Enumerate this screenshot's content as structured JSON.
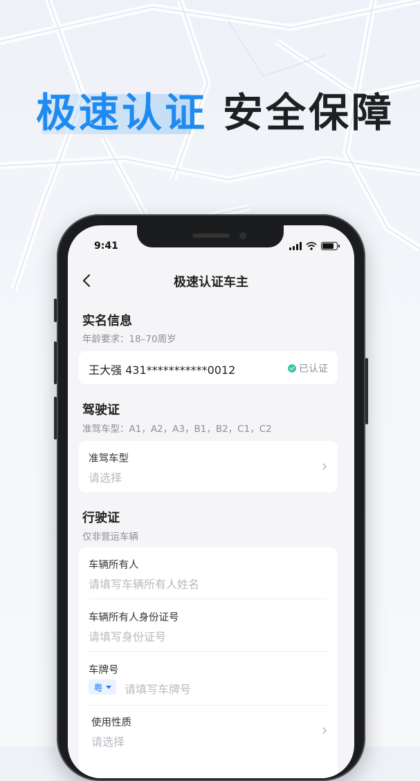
{
  "headline": {
    "blue": "极速认证",
    "dark": "安全保障"
  },
  "status": {
    "time": "9:41",
    "battery_level": 0.9
  },
  "nav": {
    "title": "极速认证车主"
  },
  "realname": {
    "title": "实名信息",
    "subtitle": "年龄要求：18–70周岁",
    "identity": "王大强 431***********0012",
    "status": "已认证"
  },
  "license": {
    "title": "驾驶证",
    "subtitle": "准驾车型：A1，A2，A3，B1，B2，C1，C2",
    "field_label": "准驾车型",
    "field_placeholder": "请选择"
  },
  "vehicle": {
    "title": "行驶证",
    "subtitle": "仅非营运车辆",
    "fields": [
      {
        "label": "车辆所有人",
        "placeholder": "请填写车辆所有人姓名"
      },
      {
        "label": "车辆所有人身份证号",
        "placeholder": "请填写身份证号"
      },
      {
        "label": "车牌号",
        "placeholder": "请填写车牌号",
        "province": "粤"
      },
      {
        "label": "使用性质",
        "placeholder": "请选择"
      }
    ]
  },
  "colors": {
    "brand_blue": "#1f8bf0",
    "verified_green": "#3ec6a8"
  }
}
